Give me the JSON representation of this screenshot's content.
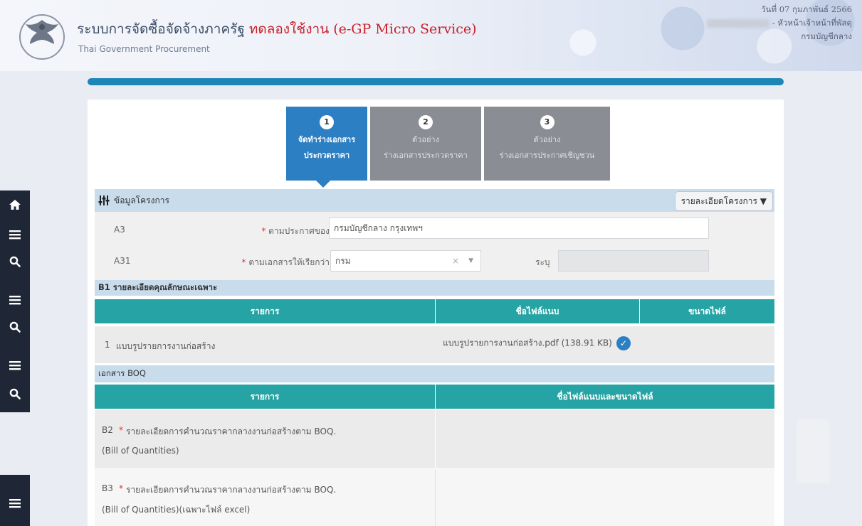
{
  "header": {
    "title_main": "ระบบการจัดซื้อจัดจ้างภาครัฐ",
    "title_accent": "ทดลองใช้งาน (e-GP Micro Service)",
    "subtitle": "Thai Government Procurement",
    "date": "วันที่ 07 กุมภาพันธ์ 2566",
    "role": "- หัวหน้าเจ้าหน้าที่พัสดุ",
    "department": "กรมบัญชีกลาง"
  },
  "sidebar": {
    "icons": [
      "home-icon",
      "menu-icon",
      "search-icon",
      "menu-icon",
      "search-icon",
      "menu-icon",
      "search-icon"
    ]
  },
  "steps": [
    {
      "num": "1",
      "line1": "จัดทำร่างเอกสาร",
      "line2": "ประกวดราคา",
      "active": true
    },
    {
      "num": "2",
      "line1": "ตัวอย่าง",
      "line2": "ร่างเอกสารประกวดราคา",
      "active": false
    },
    {
      "num": "3",
      "line1": "ตัวอย่าง",
      "line2": "ร่างเอกสารประกาศเชิญชวน",
      "active": false
    }
  ],
  "project_section": {
    "title": "ข้อมูลโครงการ",
    "detail_button": "รายละเอียดโครงการ",
    "a3_code": "A3",
    "a3_label": "ตามประกาศของ",
    "a3_value": "กรมบัญชีกลาง กรุงเทพฯ",
    "a31_code": "A31",
    "a31_label": "ตามเอกสารให้เรียกว่า",
    "a31_value": "กรม",
    "specify_label": "ระบุ",
    "specify_value": ""
  },
  "b1_section": {
    "title": "B1 รายละเอียดคุณลักษณะเฉพาะ",
    "columns": [
      "รายการ",
      "ชื่อไฟล์แนบ",
      "ขนาดไฟล์"
    ],
    "rows": [
      {
        "no": "1",
        "item": "แบบรูปรายการงานก่อสร้าง",
        "file": "แบบรูปรายการงานก่อสร้าง.pdf (138.91 KB)",
        "size": ""
      }
    ]
  },
  "boq_section": {
    "title": "เอกสาร BOQ",
    "columns": [
      "รายการ",
      "ชื่อไฟล์แนบและขนาดไฟล์"
    ],
    "rows": [
      {
        "code": "B2",
        "line1": "รายละเอียดการคำนวณราคากลางงานก่อสร้างตาม BOQ.",
        "line2": "(Bill of Quantities)"
      },
      {
        "code": "B3",
        "line1": "รายละเอียดการคำนวณราคากลางงานก่อสร้างตาม BOQ.",
        "line2": "(Bill of Quantities)(เฉพาะไฟล์ excel)"
      }
    ]
  },
  "colors": {
    "primary": "#2c7fc2",
    "teal": "#26a3a4",
    "section": "#c9dcec",
    "sidebar": "#1f2736",
    "accent_red": "#c8202a"
  }
}
